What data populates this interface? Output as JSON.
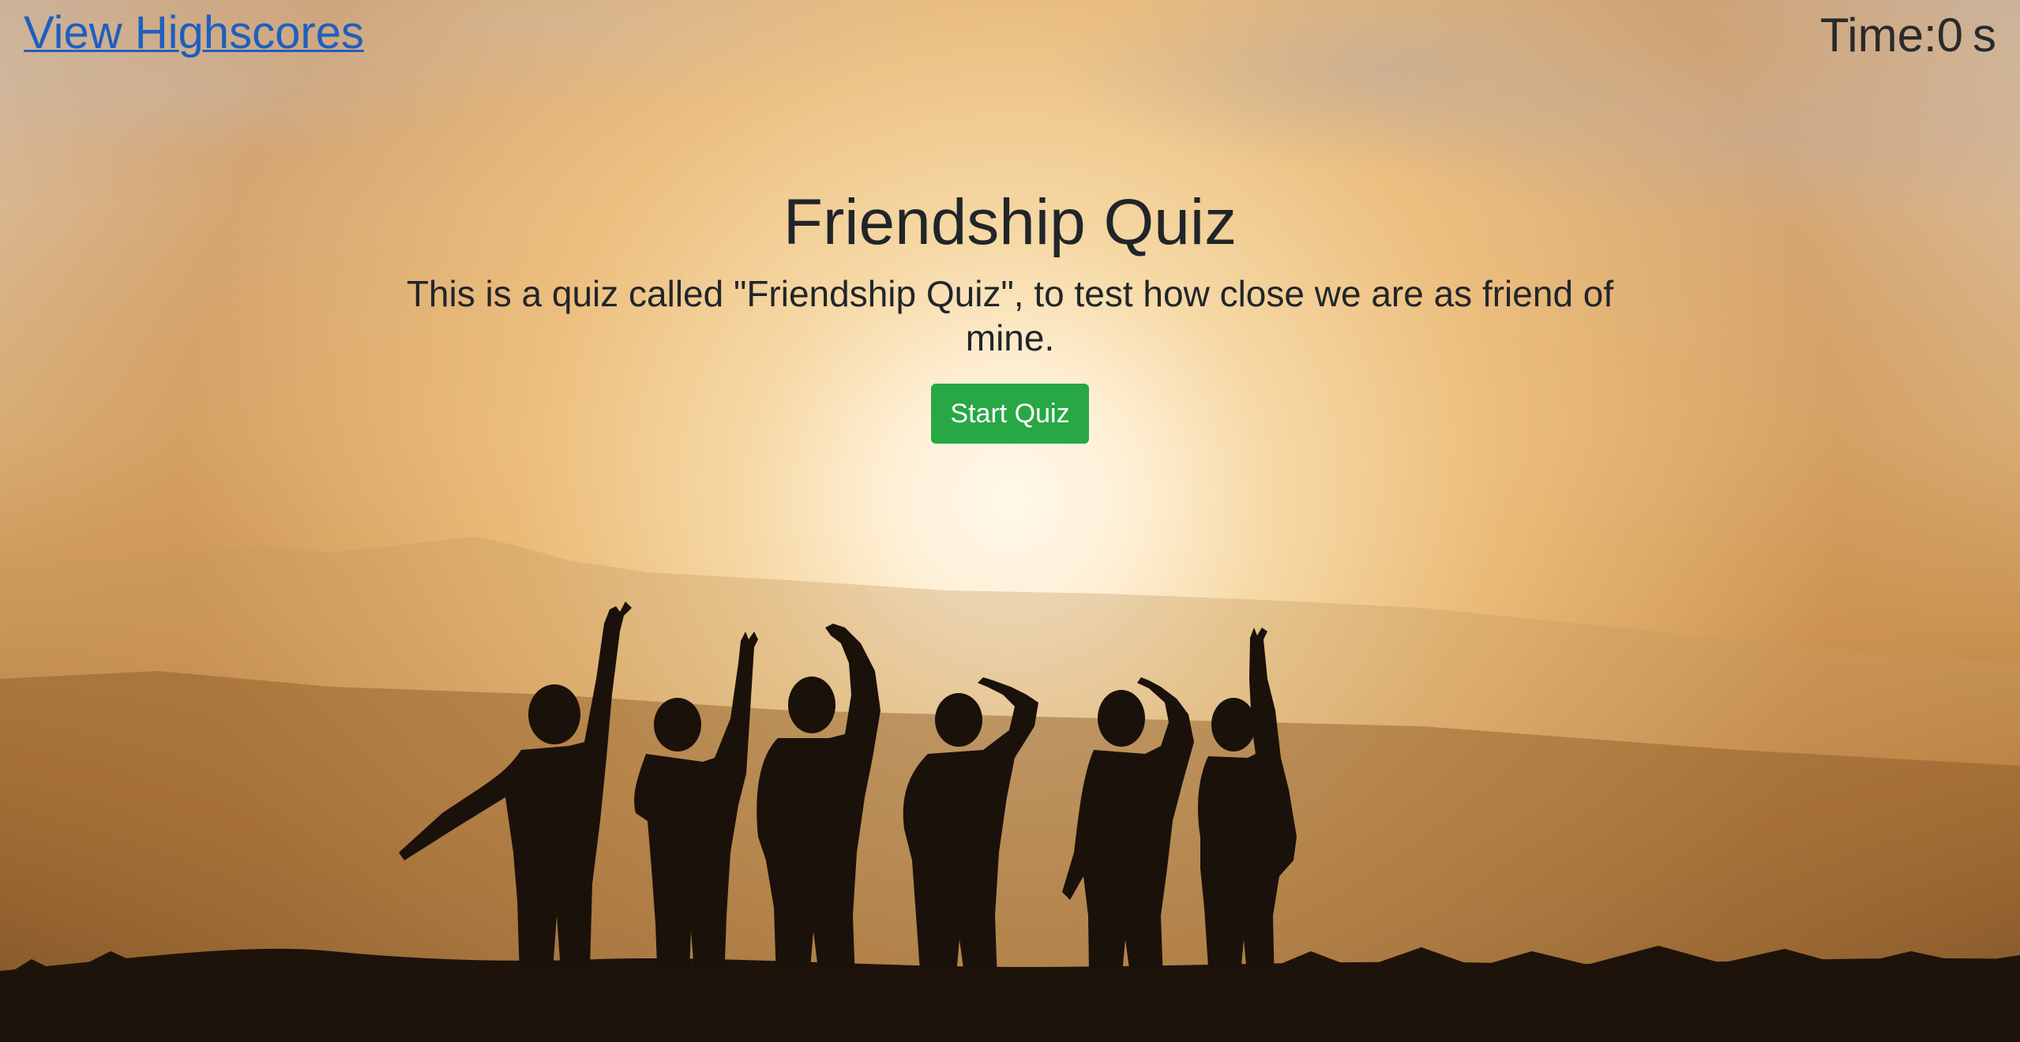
{
  "header": {
    "highscores_link": "View Highscores",
    "timer_label": "Time:",
    "timer_value": "0",
    "timer_unit": "s"
  },
  "hero": {
    "title": "Friendship Quiz",
    "description": "This is a quiz called \"Friendship Quiz\", to test how close we are as friend of mine.",
    "start_button": "Start Quiz"
  },
  "colors": {
    "link": "#1f5fbf",
    "start_button_bg": "#28a745",
    "text": "#212529"
  }
}
